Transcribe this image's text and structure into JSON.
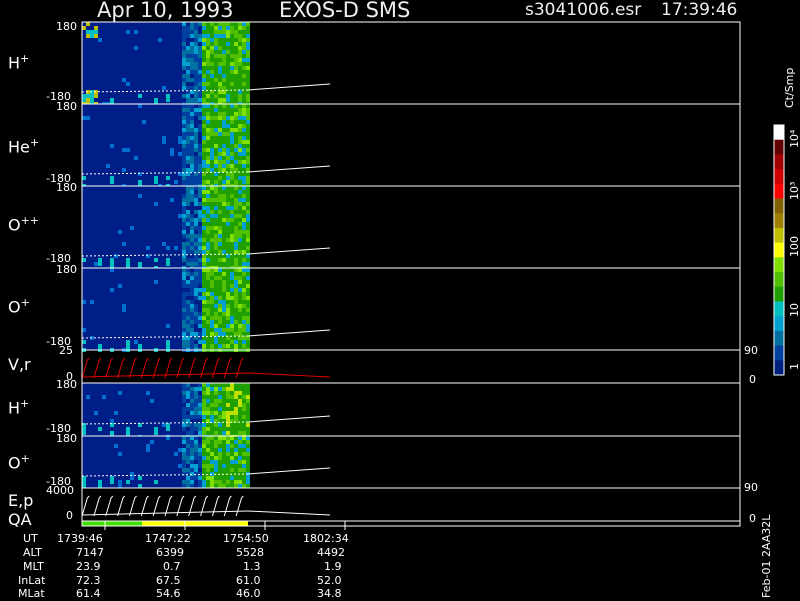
{
  "header": {
    "date": "Apr 10, 1993",
    "instrument": "EXOS-D SMS",
    "file": "s3041006.esr",
    "time": "17:39:46"
  },
  "panels": [
    {
      "id": "h-plus-1",
      "species": "H",
      "charge": "+",
      "top": "180",
      "bottom": "-180"
    },
    {
      "id": "he-plus",
      "species": "He",
      "charge": "+",
      "top": "180",
      "bottom": "-180"
    },
    {
      "id": "o-plus-plus",
      "species": "O",
      "charge": "++",
      "top": "180",
      "bottom": "-180"
    },
    {
      "id": "o-plus-1",
      "species": "O",
      "charge": "+",
      "top": "180",
      "bottom": "-180"
    },
    {
      "id": "vr",
      "species": "V,r",
      "charge": "",
      "top": "25",
      "bottom": "0",
      "right_top": "90",
      "right_bottom": "0"
    },
    {
      "id": "h-plus-2",
      "species": "H",
      "charge": "+",
      "top": "180",
      "bottom": "-180"
    },
    {
      "id": "o-plus-2",
      "species": "O",
      "charge": "+",
      "top": "180",
      "bottom": "-180"
    },
    {
      "id": "ep",
      "species": "E,p",
      "charge": "",
      "top": "4000",
      "bottom": "0",
      "right_top": "90",
      "right_bottom": "0"
    }
  ],
  "qa_label": "QA",
  "colorbar": {
    "title": "Ct/Smp",
    "ticks": [
      "10⁴",
      "10³",
      "100",
      "10",
      "1"
    ],
    "colors": [
      "#ffffff",
      "#600000",
      "#a00000",
      "#d00000",
      "#ff0000",
      "#806000",
      "#a08000",
      "#c0c000",
      "#ffff00",
      "#80e000",
      "#50c000",
      "#20a000",
      "#00c0c0",
      "#00a0d0",
      "#0070a0",
      "#0040a0",
      "#002080"
    ]
  },
  "footer": {
    "labels": [
      "UT",
      "ALT",
      "MLT",
      "InLat",
      "MLat"
    ],
    "columns": [
      [
        "1739:46",
        "7147",
        "23.9",
        "72.3",
        "61.4"
      ],
      [
        "1747:22",
        "6399",
        "0.7",
        "67.5",
        "54.6"
      ],
      [
        "1754:50",
        "5528",
        "1.3",
        "61.0",
        "46.0"
      ],
      [
        "1802:34",
        "4492",
        "1.9",
        "52.0",
        "34.8"
      ]
    ],
    "plot_date": "Feb-01 2AA32L"
  },
  "chart_data": {
    "type": "heatmap",
    "title": "Apr 10, 1993   EXOS-D SMS",
    "x_ticks": [
      "1739:46",
      "1747:22",
      "1754:50",
      "1802:34"
    ],
    "y_ticks_pitch": [
      "180",
      "-180"
    ],
    "colorbar_ticks": [
      "1",
      "10",
      "100",
      "10³",
      "10⁴"
    ],
    "colorbar_unit": "Ct/Smp",
    "data_coverage_x": [
      "1739:46",
      "1754:50"
    ]
  }
}
